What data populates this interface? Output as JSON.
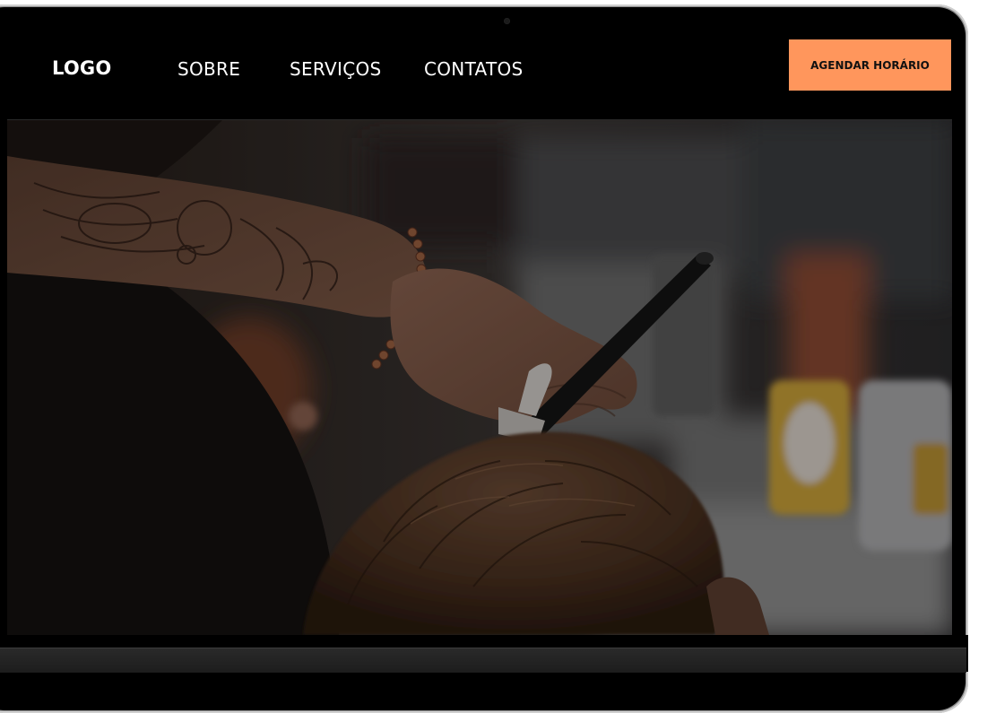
{
  "header": {
    "logo": "LOGO",
    "nav": [
      {
        "label": "SOBRE"
      },
      {
        "label": "SERVIÇOS"
      },
      {
        "label": "CONTATOS"
      }
    ],
    "cta_label": "AGENDAR HORÁRIO"
  },
  "hero": {
    "image": "barber-cutting-hair-photo"
  },
  "colors": {
    "accent": "#ff965c",
    "background": "#000000",
    "text": "#ffffff"
  }
}
